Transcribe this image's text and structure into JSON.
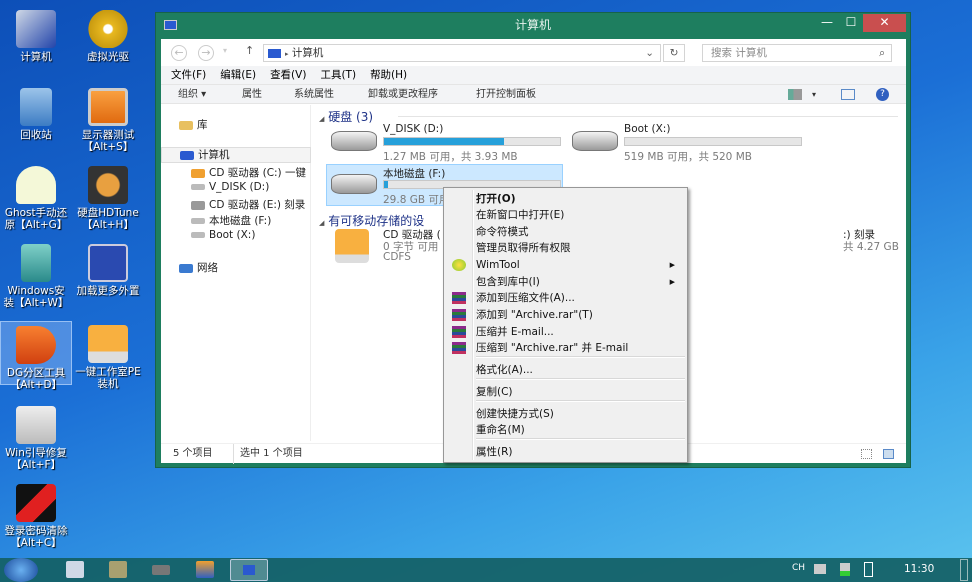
{
  "desktop": {
    "icons": [
      {
        "label": "计算机",
        "sub": ""
      },
      {
        "label": "虚拟光驱",
        "sub": ""
      },
      {
        "label": "回收站",
        "sub": ""
      },
      {
        "label": "显示器测试",
        "sub": "【Alt+S】"
      },
      {
        "label": "Ghost手动还",
        "sub": "原【Alt+G】"
      },
      {
        "label": "硬盘HDTune",
        "sub": "【Alt+H】"
      },
      {
        "label": "Windows安",
        "sub": "装【Alt+W】"
      },
      {
        "label": "加载更多外置",
        "sub": ""
      },
      {
        "label": "DG分区工具",
        "sub": "【Alt+D】"
      },
      {
        "label": "一键工作室PE",
        "sub": "装机"
      },
      {
        "label": "Win引导修复",
        "sub": "【Alt+F】"
      },
      {
        "label": "登录密码清除",
        "sub": "【Alt+C】"
      }
    ]
  },
  "window": {
    "title": "计算机",
    "close": "✕",
    "minimize": "—",
    "maximize": "☐",
    "address": {
      "path": "计算机",
      "search_placeholder": "搜索 计算机"
    },
    "menu": [
      "文件(F)",
      "编辑(E)",
      "查看(V)",
      "工具(T)",
      "帮助(H)"
    ],
    "commands": [
      "组织 ▾",
      "属性",
      "系统属性",
      "卸载或更改程序",
      "打开控制面板"
    ],
    "nav": {
      "library": "库",
      "computer": "计算机",
      "drives": [
        "CD 驱动器 (C:) 一键",
        "V_DISK (D:)",
        "CD 驱动器 (E:) 刻录",
        "本地磁盘 (F:)",
        "Boot (X:)"
      ],
      "network": "网络"
    },
    "groups": {
      "hdd": "硬盘 (3)",
      "removable": "有可移动存储的设"
    },
    "drives": [
      {
        "name": "V_DISK (D:)",
        "size": "1.27 MB 可用，共 3.93 MB",
        "used_pct": 68
      },
      {
        "name": "Boot (X:)",
        "size": "519 MB 可用，共 520 MB",
        "used_pct": 0
      },
      {
        "name": "本地磁盘 (F:)",
        "size": "29.8 GB 可用",
        "used_pct": 2
      }
    ],
    "removable": [
      {
        "name": "CD 驱动器 (",
        "size": "0 字节 可用",
        "fs": "CDFS"
      },
      {
        "name": ":) 刻录",
        "size": "共 4.27 GB"
      }
    ],
    "status": {
      "count": "5 个项目",
      "selected": "选中 1 个项目"
    }
  },
  "context_menu": {
    "items": [
      "打开(O)",
      "在新窗口中打开(E)",
      "命令符模式",
      "管理员取得所有权限",
      "WimTool",
      "包含到库中(I)",
      "添加到压缩文件(A)...",
      "添加到 \"Archive.rar\"(T)",
      "压缩并 E-mail...",
      "压缩到 \"Archive.rar\" 并 E-mail",
      "格式化(A)...",
      "复制(C)",
      "创建快捷方式(S)",
      "重命名(M)",
      "属性(R)"
    ]
  },
  "taskbar": {
    "lang": "CH",
    "clock": "11:30"
  }
}
